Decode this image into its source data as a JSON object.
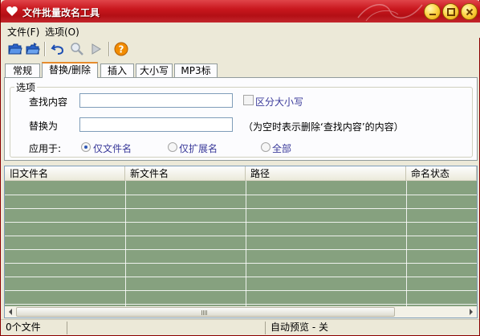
{
  "window": {
    "title": "文件批量改名工具"
  },
  "menu": {
    "file": "文件(F)",
    "options": "选项(O)"
  },
  "toolbar": {
    "icons": [
      "open-folder-icon",
      "save-icon",
      "undo-icon",
      "find-icon",
      "run-icon",
      "help-icon"
    ],
    "help_color": "#f28c00"
  },
  "tabs": [
    "常规",
    "替换/删除",
    "插入",
    "大小写",
    "MP3标签"
  ],
  "active_tab": "替换/删除",
  "options_group": {
    "legend": "选项",
    "find_label": "查找内容",
    "find_value": "",
    "case_label": "区分大小写",
    "replace_label": "替换为",
    "replace_value": "",
    "replace_hint": "（为空时表示删除‘查找内容’的内容）",
    "apply_label": "应用于:",
    "radio_filename": "仅文件名",
    "radio_ext": "仅扩展名",
    "radio_all": "全部",
    "selected_scope": "仅文件名"
  },
  "list": {
    "columns": [
      "旧文件名",
      "新文件名",
      "路径",
      "命名状态"
    ],
    "rows": [],
    "body_color": "#86a17f"
  },
  "status": {
    "file_count": "0个文件",
    "middle": "",
    "preview": "自动预览 - 关"
  }
}
